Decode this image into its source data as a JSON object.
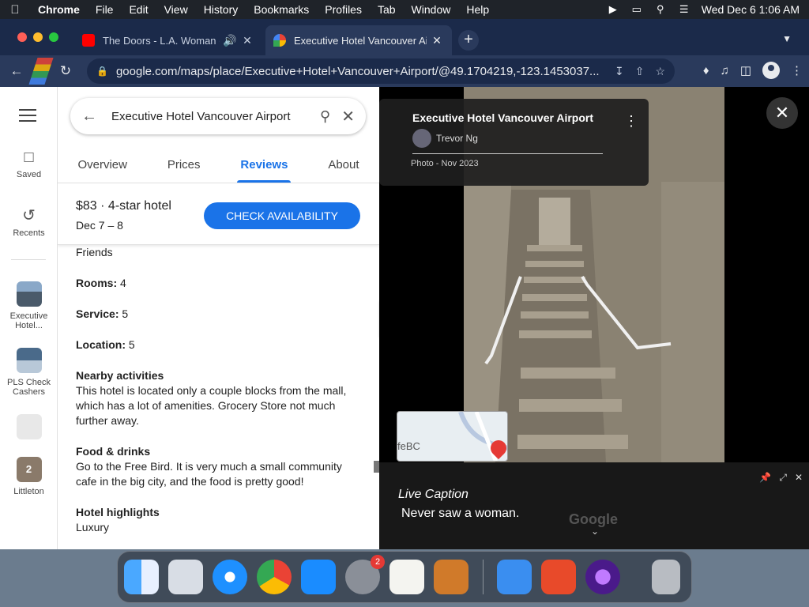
{
  "menubar": {
    "app_name": "Chrome",
    "items": [
      "File",
      "Edit",
      "View",
      "History",
      "Bookmarks",
      "Profiles",
      "Tab",
      "Window",
      "Help"
    ],
    "clock": "Wed Dec 6  1:06 AM"
  },
  "tabs": [
    {
      "title": "The Doors - L.A. Woman (",
      "favicon": "youtube-icon",
      "audio": true
    },
    {
      "title": "Executive Hotel Vancouver Air",
      "favicon": "google-maps-icon",
      "active": true
    }
  ],
  "address_bar": {
    "url": "google.com/maps/place/Executive+Hotel+Vancouver+Airport/@49.1704219,-123.1453037..."
  },
  "rail": {
    "saved_label": "Saved",
    "recents_label": "Recents",
    "recent_places": [
      {
        "label": "Executive Hotel..."
      },
      {
        "label": "PLS Check Cashers"
      },
      {
        "label": ""
      },
      {
        "label": "Littleton",
        "count": "2"
      }
    ]
  },
  "panel": {
    "search_query": "Executive Hotel Vancouver Airport",
    "tabs": [
      "Overview",
      "Prices",
      "Reviews",
      "About"
    ],
    "active_tab": "Reviews",
    "price_summary": "$83 · 4-star hotel",
    "date_range": "Dec 7 – 8",
    "check_button": "CHECK AVAILABILITY",
    "review": {
      "trip_type": "Friends",
      "rooms_label": "Rooms:",
      "rooms_value": " 4",
      "service_label": "Service:",
      "service_value": " 5",
      "location_label": "Location:",
      "location_value": " 5",
      "nearby_heading": "Nearby activities",
      "nearby_text": "This hotel is located only a couple blocks from the mall, which has a lot of amenities. Grocery Store not much further away.",
      "food_heading": "Food & drinks",
      "food_text": "Go to the Free Bird. It is very much a small community cafe in the big city, and the food is pretty good!",
      "highlights_heading": "Hotel highlights",
      "highlights_text": "Luxury"
    }
  },
  "viewer": {
    "title": "Executive Hotel Vancouver Airport",
    "author": "Trevor Ng",
    "photo_date": "Photo - Nov 2023",
    "minimap_label": "feBC"
  },
  "live_caption": {
    "title": "Live Caption",
    "text": "Never saw a woman.",
    "watermark": "Google"
  },
  "dock": {
    "settings_badge": "2"
  }
}
